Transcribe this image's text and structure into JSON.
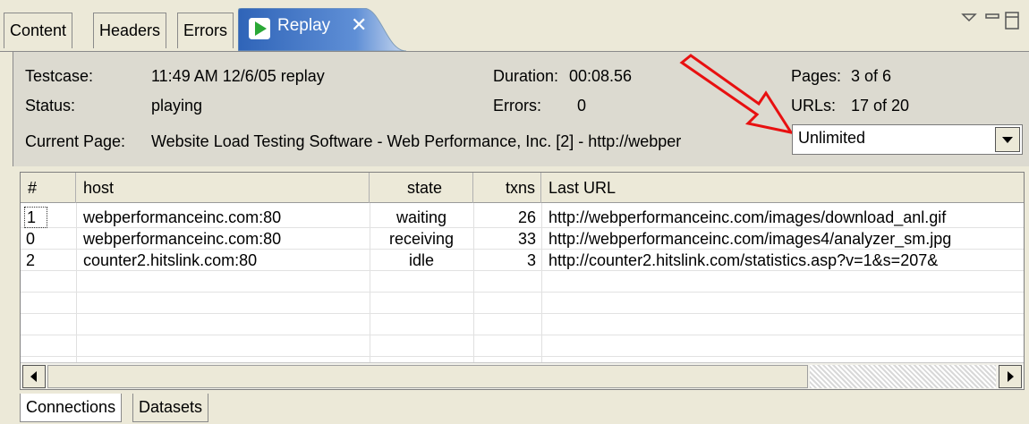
{
  "tabs": {
    "content": "Content",
    "headers": "Headers",
    "errors": "Errors",
    "replay": "Replay"
  },
  "info": {
    "testcase_label": "Testcase:",
    "testcase_value": "11:49 AM 12/6/05 replay",
    "status_label": "Status:",
    "status_value": "playing",
    "duration_label": "Duration:",
    "duration_value": "00:08.56",
    "errors_label": "Errors:",
    "errors_value": "0",
    "pages_label": "Pages:",
    "pages_value": "3 of 6",
    "urls_label": "URLs:",
    "urls_value": "17 of 20",
    "current_page_label": "Current Page:",
    "current_page_value": "Website Load Testing Software - Web Performance, Inc. [2] - http://webper"
  },
  "speed_select": {
    "value": "Unlimited"
  },
  "table": {
    "columns": [
      "#",
      "host",
      "state",
      "txns",
      "Last URL"
    ],
    "rows": [
      {
        "num": "1",
        "host": "webperformanceinc.com:80",
        "state": "waiting",
        "txns": "26",
        "url": "http://webperformanceinc.com/images/download_anl.gif"
      },
      {
        "num": "0",
        "host": "webperformanceinc.com:80",
        "state": "receiving",
        "txns": "33",
        "url": "http://webperformanceinc.com/images4/analyzer_sm.jpg"
      },
      {
        "num": "2",
        "host": "counter2.hitslink.com:80",
        "state": "idle",
        "txns": "3",
        "url": "http://counter2.hitslink.com/statistics.asp?v=1&s=207&"
      }
    ]
  },
  "bottom_tabs": {
    "connections": "Connections",
    "datasets": "Datasets"
  },
  "colors": {
    "active_tab": "#3d73c4",
    "arrow": "#e81010",
    "panel": "#ece9d8"
  }
}
